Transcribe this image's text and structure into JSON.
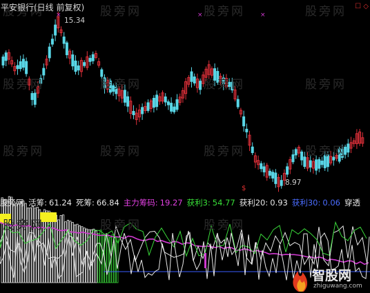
{
  "title": "平安银行(日线 前复权)",
  "watermark": "股旁网",
  "price_high_label": "15.34",
  "price_low_label": "8.97",
  "dollar_marker": "$",
  "x_markers": [
    "×",
    "×",
    "×"
  ],
  "top_right_markers": "☐ ◇",
  "indicator": {
    "name": "股旁网",
    "items": [
      {
        "label": "活筹:",
        "value": "61.24",
        "color": "#e6e6e6"
      },
      {
        "label": "死筹:",
        "value": "66.84",
        "color": "#e6e6e6"
      },
      {
        "label": "主力筹码:",
        "value": "19.27",
        "color": "#e040e0"
      },
      {
        "label": "获利3:",
        "value": "54.77",
        "color": "#38e038"
      },
      {
        "label": "获利20:",
        "value": "0.93",
        "color": "#e6e6e6"
      },
      {
        "label": "获利30:",
        "value": "0.06",
        "color": "#4a6cff"
      },
      {
        "label": "穿透",
        "value": "",
        "color": "#e6e6e6"
      }
    ]
  },
  "logo": {
    "name": "智股网",
    "url": "zhiguwang.com"
  },
  "colors": {
    "up": "#e0303a",
    "down": "#59d6e6",
    "white": "#e8e8e8",
    "magenta": "#d23ad2",
    "green": "#3ad83a",
    "yellow": "#f5f020",
    "blue": "#3a5cff"
  }
}
